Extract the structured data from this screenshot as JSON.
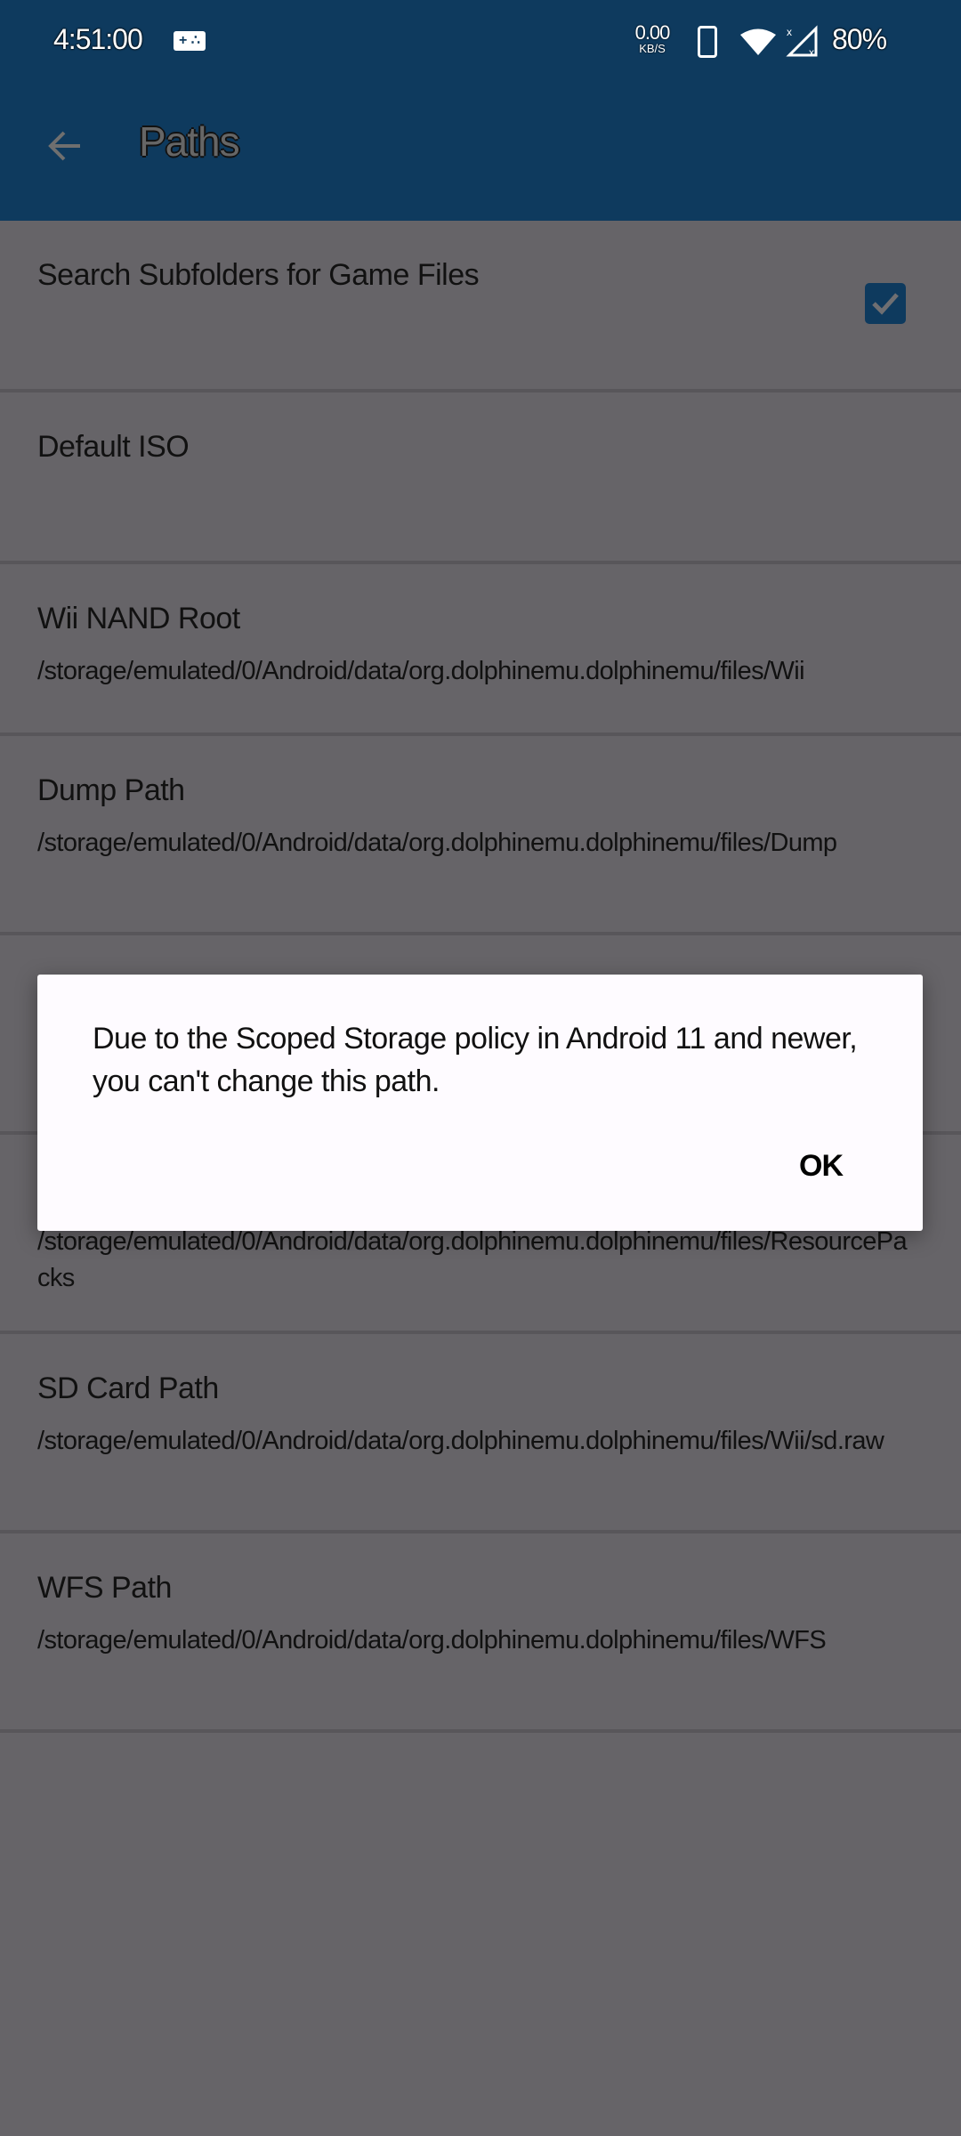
{
  "status_bar": {
    "time": "4:51:00",
    "notification_icon": "gamepad-icon",
    "net_speed_value": "0.00",
    "net_speed_unit": "KB/S",
    "icons": [
      "phone-icon",
      "wifi-icon",
      "signal-no-service-icon"
    ],
    "battery": "80%"
  },
  "app_bar": {
    "back_icon": "arrow-left-icon",
    "title": "Paths"
  },
  "settings": [
    {
      "title": "Search Subfolders for Game Files",
      "summary": "",
      "checked": true
    },
    {
      "title": "Default ISO",
      "summary": ""
    },
    {
      "title": "Wii NAND Root",
      "summary": "/storage/emulated/0/Android/data/org.dolphinemu.dolphinemu/files/Wii"
    },
    {
      "title": "Dump Path",
      "summary": "/storage/emulated/0/Android/data/org.dolphinemu.dolphinemu/files/Dump"
    },
    {
      "title": "",
      "summary": ""
    },
    {
      "title": "",
      "summary": "/storage/emulated/0/Android/data/org.dolphinemu.dolphinemu/files/ResourcePacks"
    },
    {
      "title": "SD Card Path",
      "summary": "/storage/emulated/0/Android/data/org.dolphinemu.dolphinemu/files/Wii/sd.raw"
    },
    {
      "title": "WFS Path",
      "summary": "/storage/emulated/0/Android/data/org.dolphinemu.dolphinemu/files/WFS"
    }
  ],
  "dialog": {
    "message": "Due to the Scoped Storage policy in Android 11 and newer, you can't change this path.",
    "ok_label": "OK"
  },
  "colors": {
    "app_bar": "#0E3A5E",
    "scrim_background": "#666468",
    "dialog_background": "#FEFBFF",
    "divider": "#58565A"
  }
}
